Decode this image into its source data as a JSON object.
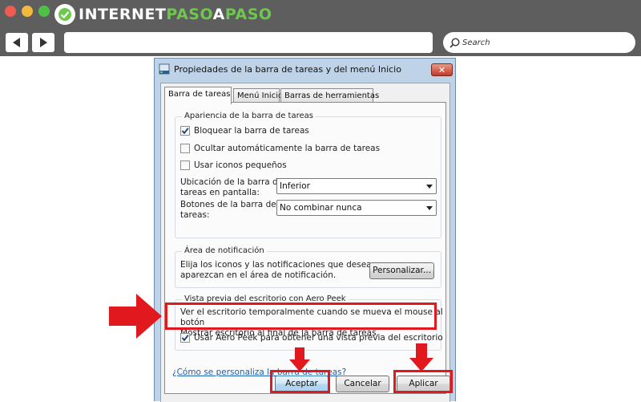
{
  "browser": {
    "logo_text_a": "INTERNET",
    "logo_text_b": "PASO",
    "logo_text_c": "A",
    "logo_text_d": "PASO",
    "search_placeholder": "Search",
    "brand_color": "#6ec74e"
  },
  "dialog": {
    "title": "Propiedades de la barra de tareas y del menú Inicio",
    "tabs": [
      {
        "label": "Barra de tareas",
        "active": true
      },
      {
        "label": "Menú Inicio",
        "active": false
      },
      {
        "label": "Barras de herramientas",
        "active": false
      }
    ],
    "appearance": {
      "legend": "Apariencia de la barra de tareas",
      "options": [
        {
          "label": "Bloquear la barra de tareas",
          "checked": true
        },
        {
          "label": "Ocultar automáticamente la barra de tareas",
          "checked": false
        },
        {
          "label": "Usar iconos pequeños",
          "checked": false
        }
      ],
      "location_label_1": "Ubicación de la barra de",
      "location_label_2": "tareas en pantalla:",
      "location_value": "Inferior",
      "buttons_label_1": "Botones de la barra de",
      "buttons_label_2": "tareas:",
      "buttons_value": "No combinar nunca"
    },
    "notification": {
      "legend": "Área de notificación",
      "text_1": "Elija los iconos y las notificaciones que desea que",
      "text_2": "aparezcan en el área de notificación.",
      "customize_label": "Personalizar..."
    },
    "aero_peek": {
      "legend": "Vista previa del escritorio con Aero Peek",
      "text_1": "Ver el escritorio temporalmente cuando se mueva el mouse al botón",
      "text_2": "Mostrar escritorio al final de la barra de tareas.",
      "option_label": "Usar Aero Peek para obtener una vista previa del escritorio",
      "option_checked": true
    },
    "help_link": "¿Cómo se personaliza la barra de tareas?",
    "buttons": {
      "ok": "Aceptar",
      "cancel": "Cancelar",
      "apply": "Aplicar"
    }
  },
  "annotations": {
    "highlight_color": "#e1181e"
  }
}
